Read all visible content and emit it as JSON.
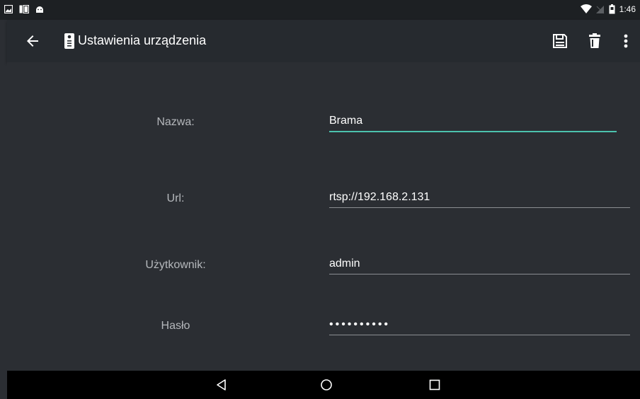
{
  "status_bar": {
    "left_icons": [
      "image-icon",
      "cast-icon",
      "android-icon"
    ],
    "right_icons": [
      "wifi-icon",
      "no-signal-icon",
      "battery-icon"
    ],
    "time": "1:46"
  },
  "toolbar": {
    "title": "Ustawienia urządzenia",
    "back_icon": "arrow-left-icon",
    "device_icon": "intercom-icon",
    "actions": [
      "save-icon",
      "delete-icon",
      "more-vert-icon"
    ]
  },
  "form": {
    "name_label": "Nazwa:",
    "name_value": "Brama",
    "url_label": "Url:",
    "url_value": "rtsp://192.168.2.131",
    "user_label": "Użytkownik:",
    "user_value": "admin",
    "password_label": "Hasło",
    "password_value": "••••••••••"
  },
  "nav_bar": {
    "buttons": [
      "back-triangle-icon",
      "home-circle-icon",
      "recents-square-icon"
    ]
  },
  "colors": {
    "background": "#2b2e33",
    "toolbar": "#262a2f",
    "status_bar": "#1d2023",
    "accent": "#4cc2ae",
    "label": "#b5b8bc"
  }
}
